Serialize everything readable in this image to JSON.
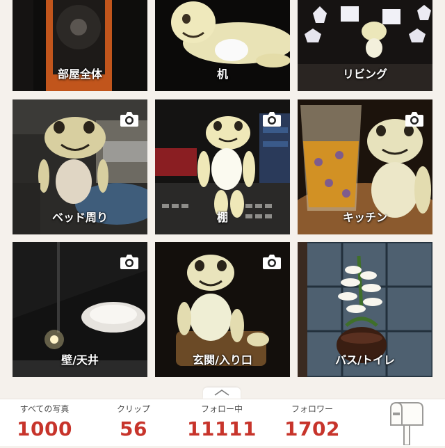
{
  "rooms": [
    {
      "label": "部屋全体",
      "camera": false
    },
    {
      "label": "机",
      "camera": false
    },
    {
      "label": "リビング",
      "camera": false
    },
    {
      "label": "ベッド周り",
      "camera": true
    },
    {
      "label": "棚",
      "camera": true
    },
    {
      "label": "キッチン",
      "camera": true
    },
    {
      "label": "壁/天井",
      "camera": true
    },
    {
      "label": "玄関/入り口",
      "camera": true
    },
    {
      "label": "バス/トイレ",
      "camera": false
    }
  ],
  "stats": {
    "all_photos_label": "すべての写真",
    "all_photos_value": "1000",
    "clips_label": "クリップ",
    "clips_value": "56",
    "following_label": "フォロー中",
    "following_value": "11111",
    "followers_label": "フォロワー",
    "followers_value": "1702"
  },
  "colors": {
    "accent": "#c7342b",
    "background": "#f5f1ec"
  },
  "icons": {
    "camera": "camera-icon",
    "mailbox": "mailbox-icon",
    "handle": "chevron-up-icon"
  }
}
